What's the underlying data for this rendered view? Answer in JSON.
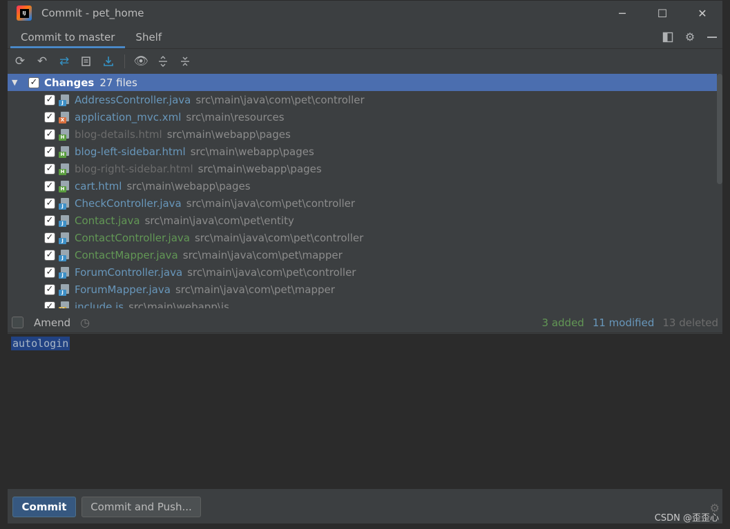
{
  "window": {
    "title": "Commit - pet_home",
    "minimize": "─",
    "maximize": "☐",
    "close": "✕"
  },
  "tabs": [
    {
      "label": "Commit to master",
      "active": true
    },
    {
      "label": "Shelf",
      "active": false
    }
  ],
  "changes": {
    "label": "Changes",
    "count": "27 files",
    "files": [
      {
        "name": "AddressController.java",
        "path": "src\\main\\java\\com\\pet\\controller",
        "status": "modified",
        "type": "java"
      },
      {
        "name": "application_mvc.xml",
        "path": "src\\main\\resources",
        "status": "modified",
        "type": "xml"
      },
      {
        "name": "blog-details.html",
        "path": "src\\main\\webapp\\pages",
        "status": "deleted",
        "type": "html"
      },
      {
        "name": "blog-left-sidebar.html",
        "path": "src\\main\\webapp\\pages",
        "status": "modified",
        "type": "html"
      },
      {
        "name": "blog-right-sidebar.html",
        "path": "src\\main\\webapp\\pages",
        "status": "deleted",
        "type": "html"
      },
      {
        "name": "cart.html",
        "path": "src\\main\\webapp\\pages",
        "status": "modified",
        "type": "html"
      },
      {
        "name": "CheckController.java",
        "path": "src\\main\\java\\com\\pet\\controller",
        "status": "modified",
        "type": "java"
      },
      {
        "name": "Contact.java",
        "path": "src\\main\\java\\com\\pet\\entity",
        "status": "added",
        "type": "java"
      },
      {
        "name": "ContactController.java",
        "path": "src\\main\\java\\com\\pet\\controller",
        "status": "added",
        "type": "java"
      },
      {
        "name": "ContactMapper.java",
        "path": "src\\main\\java\\com\\pet\\mapper",
        "status": "added",
        "type": "java"
      },
      {
        "name": "ForumController.java",
        "path": "src\\main\\java\\com\\pet\\controller",
        "status": "modified",
        "type": "java"
      },
      {
        "name": "ForumMapper.java",
        "path": "src\\main\\java\\com\\pet\\mapper",
        "status": "modified",
        "type": "java"
      },
      {
        "name": "include.js",
        "path": "src\\main\\webapp\\js",
        "status": "modified",
        "type": "js"
      }
    ]
  },
  "amend": {
    "label": "Amend",
    "checked": false
  },
  "stats": {
    "added": "3 added",
    "modified": "11 modified",
    "deleted": "13 deleted"
  },
  "commit_message": "autologin",
  "buttons": {
    "commit": "Commit",
    "commit_and_push": "Commit and Push..."
  },
  "watermark": "CSDN @歪歪心",
  "colors": {
    "added": "#629755",
    "modified": "#6897bb",
    "deleted": "#6c6c6c",
    "selection": "#4b6eaf",
    "primary_button": "#365880"
  },
  "icons": {
    "toolbar": [
      "refresh-icon",
      "rollback-icon",
      "diff-icon",
      "changelist-icon",
      "shelve-icon",
      "view-options-icon",
      "expand-all-icon",
      "collapse-all-icon"
    ],
    "tab_tools": [
      "layout-icon",
      "gear-icon",
      "minimize-panel-icon"
    ]
  }
}
